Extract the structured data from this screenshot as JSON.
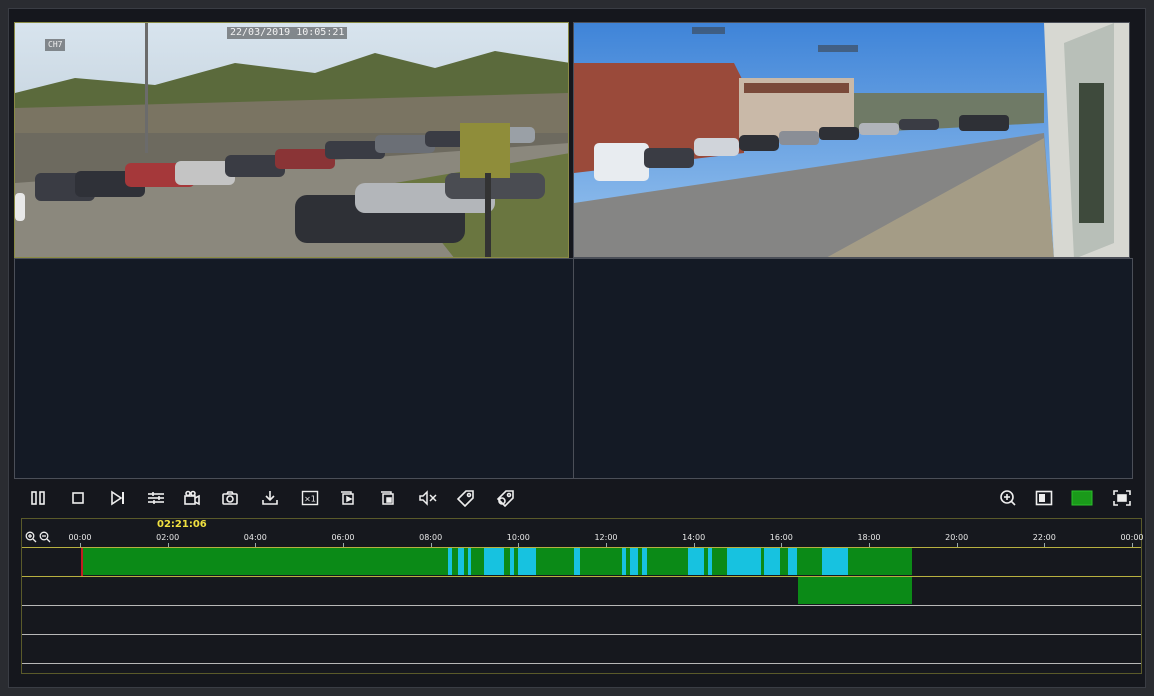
{
  "cameras": [
    {
      "channel_label": "CH7",
      "timestamp": "22/03/2019 10:05:21"
    },
    {
      "channel_label": "",
      "timestamp": ""
    }
  ],
  "toolbar": {
    "left_icons": [
      "pause-icon",
      "stop-icon",
      "step-forward-icon",
      "adjust-icon",
      "clip-icon",
      "snapshot-icon",
      "download-icon",
      "speed-icon",
      "sync-play-icon",
      "async-play-icon",
      "mute-icon",
      "tag-icon",
      "tag-manage-icon"
    ],
    "speed_label": "×1",
    "right_icons": [
      "zoom-in-icon",
      "split-screen-icon",
      "fullscreen-icon"
    ],
    "active_color": "#1a9a1a"
  },
  "timeline": {
    "current_time": "02:21:06",
    "ticks": [
      "00:00",
      "02:00",
      "04:00",
      "06:00",
      "08:00",
      "10:00",
      "12:00",
      "14:00",
      "16:00",
      "18:00",
      "20:00",
      "22:00",
      "00:00"
    ],
    "colors": {
      "normal": "#0b8a17",
      "motion": "#17c2e0",
      "track_line": "#b8b040"
    }
  }
}
